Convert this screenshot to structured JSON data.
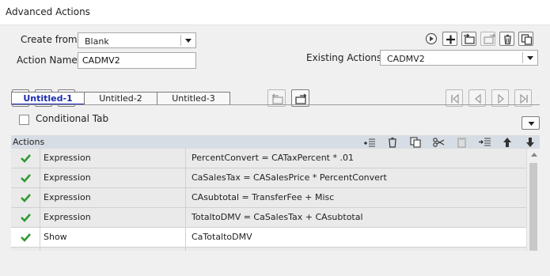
{
  "window": {
    "title": "Advanced Actions"
  },
  "form": {
    "create_from_label": "Create from:",
    "create_from_value": "Blank",
    "action_name_label": "Action Name:",
    "action_name_value": "CADMV2",
    "existing_actions_label": "Existing Actions:",
    "existing_actions_value": "CADMV2"
  },
  "tabs": [
    "Untitled-1",
    "Untitled-2",
    "Untitled-3"
  ],
  "conditional_tab_label": "Conditional Tab",
  "actions_header": "Actions",
  "actions": [
    {
      "type": "Expression",
      "statement": "PercentConvert   =   CATaxPercent    *   .01"
    },
    {
      "type": "Expression",
      "statement": "CaSalesTax   =   CASalesPrice    *   PercentConvert"
    },
    {
      "type": "Expression",
      "statement": "CAsubtotal   =   TransferFee   +   Misc"
    },
    {
      "type": "Expression",
      "statement": "TotaltoDMV   =   CaSalesTax   +   CAsubtotal"
    },
    {
      "type": "Show",
      "statement": "CaTotaltoDMV"
    }
  ],
  "colors": {
    "active_tab": "#1a2bb0",
    "check": "#2f9a2f",
    "header_bg": "#d7dde4"
  }
}
